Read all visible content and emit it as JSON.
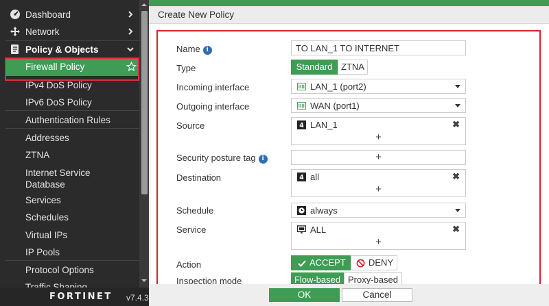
{
  "sidebar": {
    "items": [
      {
        "label": "Dashboard",
        "icon": "dashboard-icon"
      },
      {
        "label": "Network",
        "icon": "network-move-icon"
      },
      {
        "label": "Policy & Objects",
        "icon": "policy-objects-icon"
      },
      {
        "label": "Firewall Policy"
      },
      {
        "label": "IPv4 DoS Policy"
      },
      {
        "label": "IPv6 DoS Policy"
      },
      {
        "label": "Authentication Rules"
      },
      {
        "label": "Addresses"
      },
      {
        "label": "ZTNA"
      },
      {
        "label": "Internet Service Database"
      },
      {
        "label": "Services"
      },
      {
        "label": "Schedules"
      },
      {
        "label": "Virtual IPs"
      },
      {
        "label": "IP Pools"
      },
      {
        "label": "Protocol Options"
      },
      {
        "label": "Traffic Shaping"
      }
    ],
    "brand": "F̶RTINET",
    "brand_plain": "FORTINET",
    "version": "v7.4.3"
  },
  "colors": {
    "accent": "#3f9c55",
    "highlight": "#e0303a",
    "sidebar_bg": "#2b2b2b"
  },
  "page": {
    "title": "Create New Policy"
  },
  "form": {
    "name_label": "Name",
    "name_value": "TO LAN_1 TO INTERNET",
    "type_label": "Type",
    "type_options": [
      "Standard",
      "ZTNA"
    ],
    "type_selected": "Standard",
    "incoming_label": "Incoming interface",
    "incoming_value": "LAN_1 (port2)",
    "outgoing_label": "Outgoing interface",
    "outgoing_value": "WAN (port1)",
    "source_label": "Source",
    "source_value": "LAN_1",
    "posture_label": "Security posture tag",
    "destination_label": "Destination",
    "destination_value": "all",
    "schedule_label": "Schedule",
    "schedule_value": "always",
    "service_label": "Service",
    "service_value": "ALL",
    "action_label": "Action",
    "action_options": [
      "ACCEPT",
      "DENY"
    ],
    "action_selected": "ACCEPT",
    "inspection_label": "Inspection mode",
    "inspection_options": [
      "Flow-based",
      "Proxy-based"
    ],
    "inspection_selected": "Flow-based",
    "plus": "+",
    "remove": "✖"
  },
  "buttons": {
    "ok": "OK",
    "cancel": "Cancel"
  }
}
